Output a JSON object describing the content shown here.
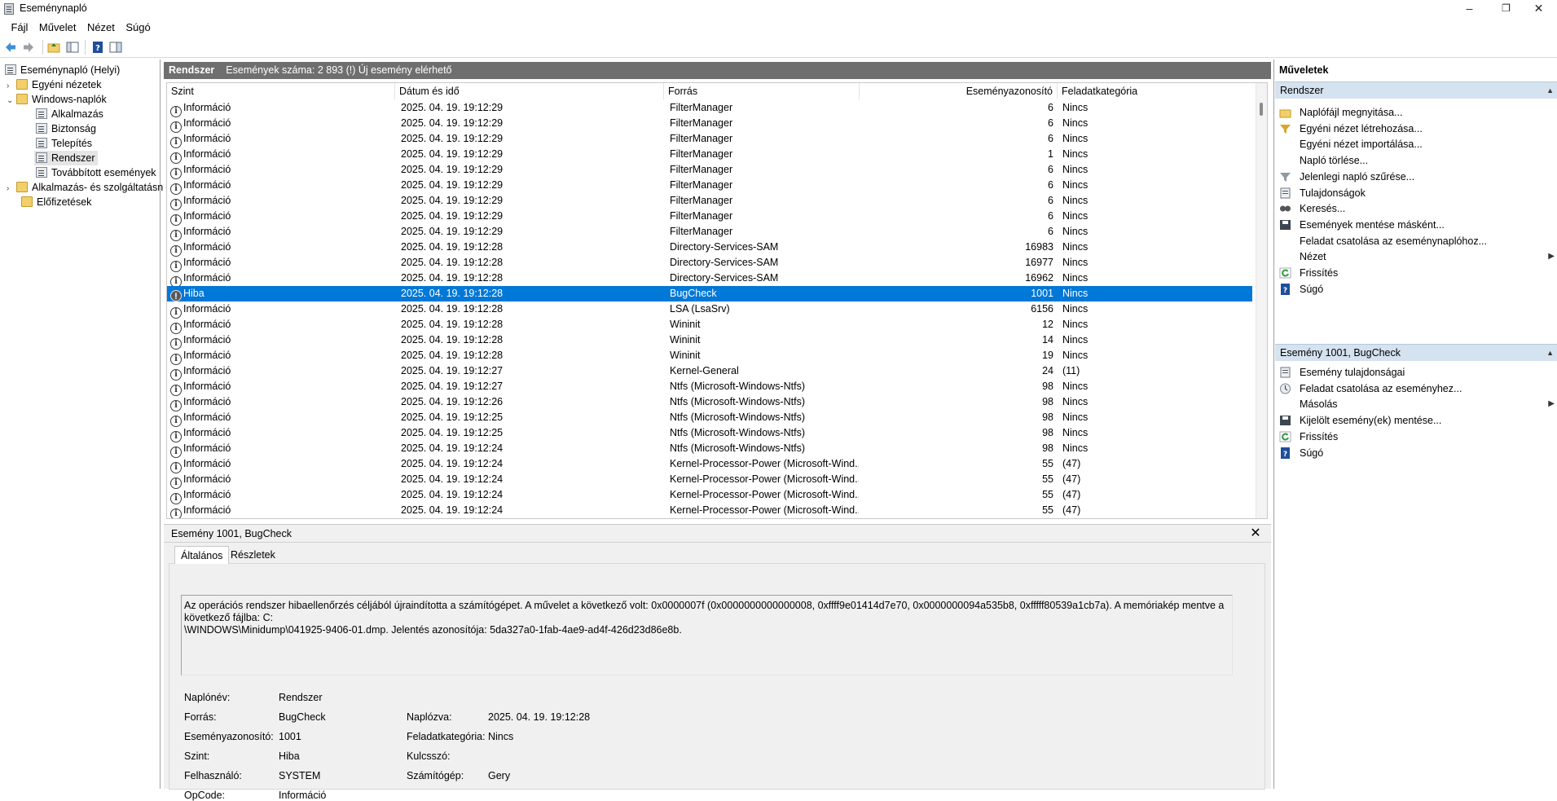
{
  "window": {
    "title": "Eseménynapló"
  },
  "menu": [
    "Fájl",
    "Művelet",
    "Nézet",
    "Súgó"
  ],
  "tree": {
    "root": "Eseménynapló (Helyi)",
    "custom_views": "Egyéni nézetek",
    "windows_logs": "Windows-naplók",
    "logs": [
      "Alkalmazás",
      "Biztonság",
      "Telepítés",
      "Rendszer",
      "Továbbított események"
    ],
    "app_services": "Alkalmazás- és szolgáltatásn",
    "subscriptions": "Előfizetések"
  },
  "center": {
    "header_name": "Rendszer",
    "header_info": "Események száma: 2 893 (!) Új esemény elérhető",
    "columns": [
      "Szint",
      "Dátum és idő",
      "Forrás",
      "Eseményazonosító",
      "Feladatkategória"
    ],
    "rows": [
      {
        "level": "Információ",
        "date": "2025. 04. 19. 19:12:29",
        "source": "FilterManager",
        "id": "6",
        "cat": "Nincs"
      },
      {
        "level": "Információ",
        "date": "2025. 04. 19. 19:12:29",
        "source": "FilterManager",
        "id": "6",
        "cat": "Nincs"
      },
      {
        "level": "Információ",
        "date": "2025. 04. 19. 19:12:29",
        "source": "FilterManager",
        "id": "6",
        "cat": "Nincs"
      },
      {
        "level": "Információ",
        "date": "2025. 04. 19. 19:12:29",
        "source": "FilterManager",
        "id": "1",
        "cat": "Nincs"
      },
      {
        "level": "Információ",
        "date": "2025. 04. 19. 19:12:29",
        "source": "FilterManager",
        "id": "6",
        "cat": "Nincs"
      },
      {
        "level": "Információ",
        "date": "2025. 04. 19. 19:12:29",
        "source": "FilterManager",
        "id": "6",
        "cat": "Nincs"
      },
      {
        "level": "Információ",
        "date": "2025. 04. 19. 19:12:29",
        "source": "FilterManager",
        "id": "6",
        "cat": "Nincs"
      },
      {
        "level": "Információ",
        "date": "2025. 04. 19. 19:12:29",
        "source": "FilterManager",
        "id": "6",
        "cat": "Nincs"
      },
      {
        "level": "Információ",
        "date": "2025. 04. 19. 19:12:29",
        "source": "FilterManager",
        "id": "6",
        "cat": "Nincs"
      },
      {
        "level": "Információ",
        "date": "2025. 04. 19. 19:12:28",
        "source": "Directory-Services-SAM",
        "id": "16983",
        "cat": "Nincs"
      },
      {
        "level": "Információ",
        "date": "2025. 04. 19. 19:12:28",
        "source": "Directory-Services-SAM",
        "id": "16977",
        "cat": "Nincs"
      },
      {
        "level": "Információ",
        "date": "2025. 04. 19. 19:12:28",
        "source": "Directory-Services-SAM",
        "id": "16962",
        "cat": "Nincs"
      },
      {
        "level": "Hiba",
        "date": "2025. 04. 19. 19:12:28",
        "source": "BugCheck",
        "id": "1001",
        "cat": "Nincs",
        "selected": true
      },
      {
        "level": "Információ",
        "date": "2025. 04. 19. 19:12:28",
        "source": "LSA (LsaSrv)",
        "id": "6156",
        "cat": "Nincs"
      },
      {
        "level": "Információ",
        "date": "2025. 04. 19. 19:12:28",
        "source": "Wininit",
        "id": "12",
        "cat": "Nincs"
      },
      {
        "level": "Információ",
        "date": "2025. 04. 19. 19:12:28",
        "source": "Wininit",
        "id": "14",
        "cat": "Nincs"
      },
      {
        "level": "Információ",
        "date": "2025. 04. 19. 19:12:28",
        "source": "Wininit",
        "id": "19",
        "cat": "Nincs"
      },
      {
        "level": "Információ",
        "date": "2025. 04. 19. 19:12:27",
        "source": "Kernel-General",
        "id": "24",
        "cat": "(11)"
      },
      {
        "level": "Információ",
        "date": "2025. 04. 19. 19:12:27",
        "source": "Ntfs (Microsoft-Windows-Ntfs)",
        "id": "98",
        "cat": "Nincs"
      },
      {
        "level": "Információ",
        "date": "2025. 04. 19. 19:12:26",
        "source": "Ntfs (Microsoft-Windows-Ntfs)",
        "id": "98",
        "cat": "Nincs"
      },
      {
        "level": "Információ",
        "date": "2025. 04. 19. 19:12:25",
        "source": "Ntfs (Microsoft-Windows-Ntfs)",
        "id": "98",
        "cat": "Nincs"
      },
      {
        "level": "Információ",
        "date": "2025. 04. 19. 19:12:25",
        "source": "Ntfs (Microsoft-Windows-Ntfs)",
        "id": "98",
        "cat": "Nincs"
      },
      {
        "level": "Információ",
        "date": "2025. 04. 19. 19:12:24",
        "source": "Ntfs (Microsoft-Windows-Ntfs)",
        "id": "98",
        "cat": "Nincs"
      },
      {
        "level": "Információ",
        "date": "2025. 04. 19. 19:12:24",
        "source": "Kernel-Processor-Power (Microsoft-Wind...",
        "id": "55",
        "cat": "(47)"
      },
      {
        "level": "Információ",
        "date": "2025. 04. 19. 19:12:24",
        "source": "Kernel-Processor-Power (Microsoft-Wind...",
        "id": "55",
        "cat": "(47)"
      },
      {
        "level": "Információ",
        "date": "2025. 04. 19. 19:12:24",
        "source": "Kernel-Processor-Power (Microsoft-Wind...",
        "id": "55",
        "cat": "(47)"
      },
      {
        "level": "Információ",
        "date": "2025. 04. 19. 19:12:24",
        "source": "Kernel-Processor-Power (Microsoft-Wind...",
        "id": "55",
        "cat": "(47)"
      }
    ]
  },
  "detail": {
    "title": "Esemény 1001, BugCheck",
    "tabs": [
      "Általános",
      "Részletek"
    ],
    "description": "Az operációs rendszer hibaellenőrzés céljából újraindította a számítógépet. A művelet a következő volt: 0x0000007f (0x0000000000000008, 0xffff9e01414d7e70, 0x0000000094a535b8, 0xfffff80539a1cb7a). A memóriakép mentve a következő fájlba: C:\n\\WINDOWS\\Minidump\\041925-9406-01.dmp. Jelentés azonosítója: 5da327a0-1fab-4ae9-ad4f-426d23d86e8b.",
    "fields": {
      "log_name_label": "Naplónév:",
      "log_name": "Rendszer",
      "source_label": "Forrás:",
      "source": "BugCheck",
      "logged_label": "Naplózva:",
      "logged": "2025. 04. 19. 19:12:28",
      "event_id_label": "Eseményazonosító:",
      "event_id": "1001",
      "task_cat_label": "Feladatkategória:",
      "task_cat": "Nincs",
      "level_label": "Szint:",
      "level": "Hiba",
      "keywords_label": "Kulcsszó:",
      "keywords": "",
      "user_label": "Felhasználó:",
      "user": "SYSTEM",
      "computer_label": "Számítógép:",
      "computer": "Gery",
      "opcode_label": "OpCode:",
      "opcode": "Információ"
    }
  },
  "actions": {
    "title": "Műveletek",
    "section1": "Rendszer",
    "items1": [
      "Naplófájl megnyitása...",
      "Egyéni nézet létrehozása...",
      "Egyéni nézet importálása...",
      "Napló törlése...",
      "Jelenlegi napló szűrése...",
      "Tulajdonságok",
      "Keresés...",
      "Események mentése másként...",
      "Feladat csatolása az eseménynaplóhoz...",
      "Nézet",
      "Frissítés",
      "Súgó"
    ],
    "section2": "Esemény 1001, BugCheck",
    "items2": [
      "Esemény tulajdonságai",
      "Feladat csatolása az eseményhez...",
      "Másolás",
      "Kijelölt esemény(ek) mentése...",
      "Frissítés",
      "Súgó"
    ]
  }
}
